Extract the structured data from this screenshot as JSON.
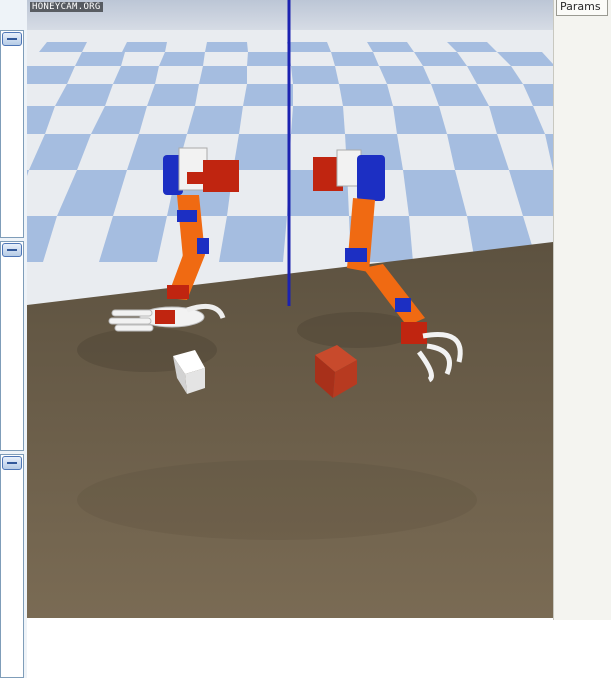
{
  "watermark": "HONEYCAM.ORG",
  "right_panel": {
    "tab_label": "Params"
  },
  "scene": {
    "sky_color": "#c5cedc",
    "floor_checker_colors": [
      "#f1f1f1",
      "#a5bde0"
    ],
    "table_color": "#6f624f",
    "arm_colors": {
      "orange": "#f06a12",
      "blue": "#1c2fc3",
      "red": "#c02510",
      "white": "#f2f2f2"
    },
    "axis_line_color": "#1c22b0",
    "objects": [
      {
        "name": "white-cube",
        "color": "#f2f2f2"
      },
      {
        "name": "red-cube",
        "color": "#c2341a"
      }
    ]
  }
}
